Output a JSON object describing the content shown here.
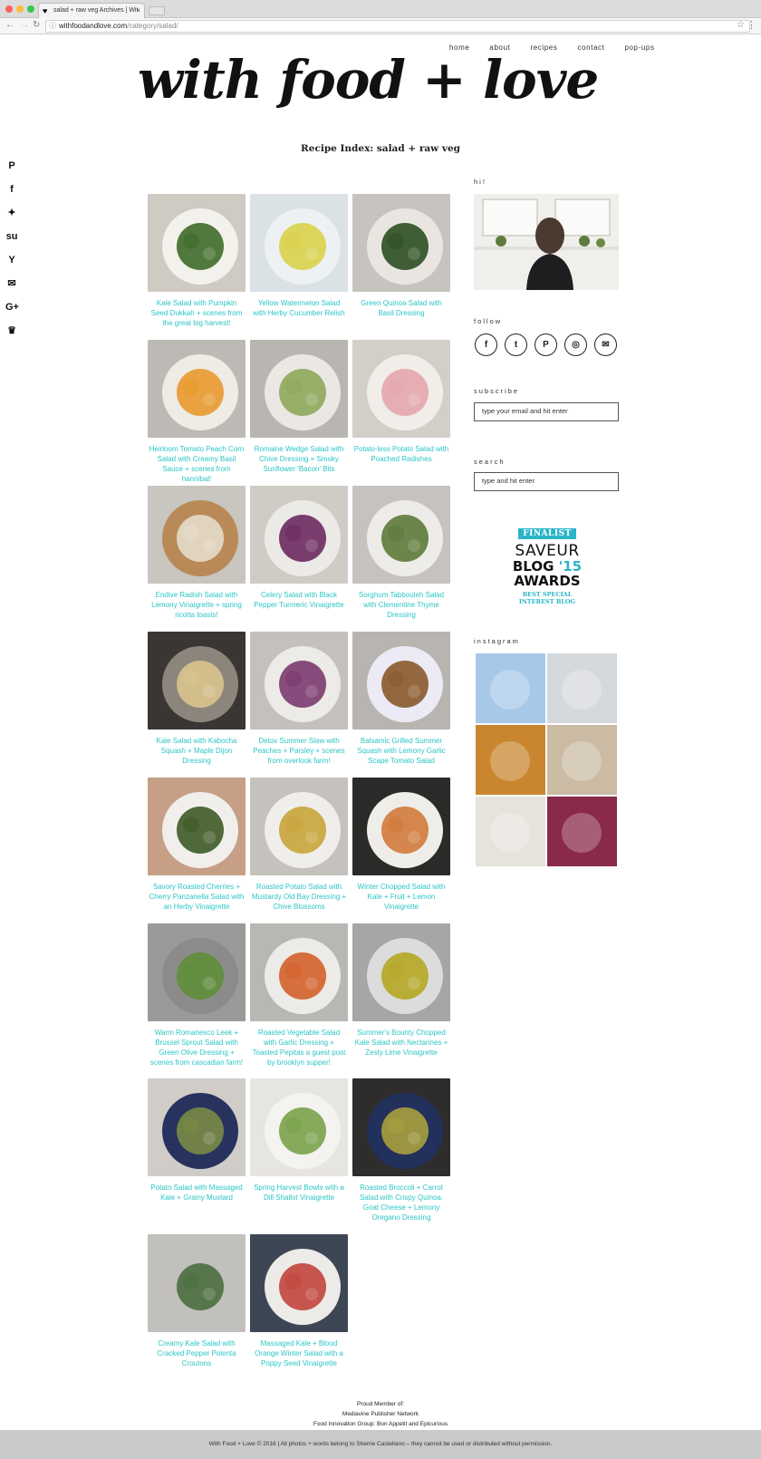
{
  "browser": {
    "tab_title": "salad + raw veg Archives | Wit",
    "url_domain": "withfoodandlove.com",
    "url_path": "/category/salad/"
  },
  "site": {
    "logo_text": "with food + love",
    "nav": [
      "home",
      "about",
      "recipes",
      "contact",
      "pop-ups"
    ]
  },
  "social_icons": [
    "pinterest-icon",
    "facebook-icon",
    "twitter-icon",
    "stumbleupon-icon",
    "yummly-icon",
    "email-icon",
    "google-plus-icon",
    "crown-icon"
  ],
  "page_title": "Recipe Index: salad + raw veg",
  "recipes": [
    {
      "title": "Kale Salad with Pumpkin Seed Dukkah + scenes from the great big harvest!",
      "bg": "#cfcac2",
      "plate": "#f3f1ec",
      "food": "#3f6b2a"
    },
    {
      "title": "Yellow Watermelon Salad with Herby Cucumber Relish",
      "bg": "#dbe2e6",
      "plate": "#eef1f3",
      "food": "#d8d14a"
    },
    {
      "title": "Green Quinoa Salad with Basil Dressing",
      "bg": "#c7c4bf",
      "plate": "#e9e6e1",
      "food": "#2e4f24"
    },
    {
      "title": "Heirloom Tomato Peach Corn Salad with Creamy Basil Sauce + scenes from hannibal!",
      "bg": "#bdbab5",
      "plate": "#efebe5",
      "food": "#e89a2c"
    },
    {
      "title": "Romaine Wedge Salad with Chive Dressing + Smoky Sunflower 'Bacon' Bits",
      "bg": "#b9b6b1",
      "plate": "#ebe8e3",
      "food": "#8fa85c"
    },
    {
      "title": "Potato-less Potato Salad with Poached Radishes",
      "bg": "#d2cec8",
      "plate": "#f1eeea",
      "food": "#e4a6ad"
    },
    {
      "title": "Endive Radish Salad with Lemony Vinaigrette + spring ricotta toasts!",
      "bg": "#c9c5bf",
      "plate": "#b98a58",
      "food": "#e6dccb"
    },
    {
      "title": "Celery Salad with Black Pepper Turmeric Vinaigrette",
      "bg": "#cfccc6",
      "plate": "#eceae6",
      "food": "#6c2a5e"
    },
    {
      "title": "Sorghum Tabbouleh Salad with Clementine Thyme Dressing",
      "bg": "#c6c3be",
      "plate": "#eeece8",
      "food": "#5d7a3a"
    },
    {
      "title": "Kale Salad with Kabocha Squash + Maple Dijon Dressing",
      "bg": "#3a3633",
      "plate": "#8b857c",
      "food": "#d9c48d"
    },
    {
      "title": "Detox Summer Slaw with Peaches + Parsley + scenes from overlook farm!",
      "bg": "#c4c1bc",
      "plate": "#ecebe7",
      "food": "#7b3b6f"
    },
    {
      "title": "Balsamic Grilled Summer Squash with Lemony Garlic Scape Tomato Salad",
      "bg": "#b8b5b0",
      "plate": "#eceaf4",
      "food": "#8a5a2e"
    },
    {
      "title": "Savory Roasted Cherries + Cherry Panzanella Salad with an Herby Vinaigrette",
      "bg": "#c79f86",
      "plate": "#f1efeb",
      "food": "#3e5a28"
    },
    {
      "title": "Roasted Potato Salad with Mustardy Old Bay Dressing + Chive Blossoms",
      "bg": "#c5c2bd",
      "plate": "#f0eeea",
      "food": "#c9a43a"
    },
    {
      "title": "Winter Chopped Salad with Kale + Fruit + Lemon Vinaigrette",
      "bg": "#2c2a28",
      "plate": "#efede8",
      "food": "#d07a3b"
    },
    {
      "title": "Warm Romanesco Leek + Brussel Sprout Salad with Green Olive Dressing + scenes from cascadian farm!",
      "bg": "#9b9a98",
      "plate": "#8c8b89",
      "food": "#5f8e3a"
    },
    {
      "title": "Roasted Vegetable Salad with Garlic Dressing + Toasted Pepitas a guest post by brooklyn supper!",
      "bg": "#b9b7b4",
      "plate": "#ecebe8",
      "food": "#d4602b"
    },
    {
      "title": "Summer's Bounty Chopped Kale Salad with Nectarines + Zesty Lime Vinaigrette",
      "bg": "#a5a6a8",
      "plate": "#dcdcdc",
      "food": "#b5a726"
    },
    {
      "title": "Potato Salad with Massaged Kale + Grainy Mustard",
      "bg": "#d0cdc8",
      "plate": "#27335e",
      "food": "#7a8a45"
    },
    {
      "title": "Spring Harvest Bowls with a Dill Shallot Vinaigrette",
      "bg": "#e7e5e1",
      "plate": "#f4f3f0",
      "food": "#7aa14a"
    },
    {
      "title": "Roasted Broccoli + Carrot Salad with Crispy Quinoa, Goat Cheese + Lemony Oregano Dressing",
      "bg": "#2e2d2c",
      "plate": "#22305c",
      "food": "#a9a03e"
    },
    {
      "title": "Creamy Kale Salad with Cracked Pepper Polenta Croutons",
      "bg": "#c2c0bc",
      "plate": "#c2c0bc",
      "food": "#4b6e3e"
    },
    {
      "title": "Massaged Kale + Blood Orange Winter Salad with a Poppy Seed Vinaigrette",
      "bg": "#3d4655",
      "plate": "#ecebe8",
      "food": "#c2453c"
    }
  ],
  "sidebar": {
    "hi_heading": "hi!",
    "follow_heading": "follow",
    "follow_icons": [
      "facebook-icon",
      "twitter-icon",
      "pinterest-icon",
      "instagram-icon",
      "email-icon"
    ],
    "subscribe_heading": "subscribe",
    "subscribe_placeholder": "type your email and hit enter",
    "search_heading": "search",
    "search_placeholder": "type and hit enter",
    "award": {
      "finalist": "FINALIST",
      "line1": "SAVEUR",
      "line2": "BLOG",
      "year": "'15",
      "line3": "AWARDS",
      "line4": "BEST SPECIAL",
      "line5": "INTEREST BLOG"
    },
    "instagram_heading": "instagram",
    "instagram_tiles": [
      "#a8c8e8",
      "#d6d9dc",
      "#c9862f",
      "#cbbba5",
      "#e7e2dc",
      "#8a2a4b"
    ]
  },
  "footer": {
    "line1": "Proud Member of:",
    "line2": "Mediavine Publisher Network",
    "line3": "Food Innovation Group: Bon Appetit and Epicurious",
    "copyright": "With Food + Love © 2016 | All photos + words belong to Sherrie Castellano – they cannot be used or distributed without permission."
  }
}
